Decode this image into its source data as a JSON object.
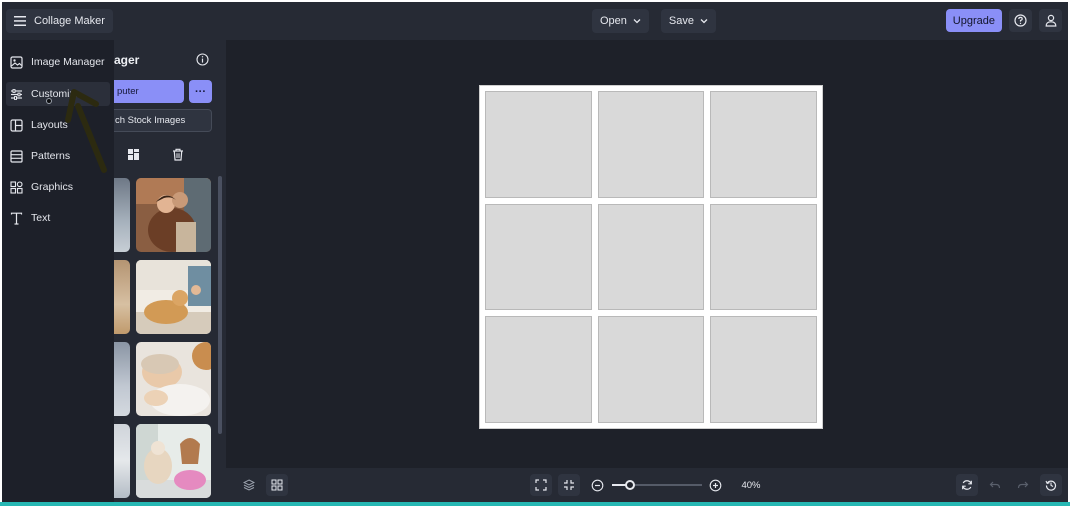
{
  "app": {
    "title": "Collage Maker"
  },
  "topbar": {
    "open_label": "Open",
    "save_label": "Save",
    "upgrade_label": "Upgrade"
  },
  "nav": {
    "items": [
      {
        "label": "Image Manager",
        "icon": "image-manager-icon"
      },
      {
        "label": "Customize",
        "icon": "sliders-icon",
        "active": true
      },
      {
        "label": "Layouts",
        "icon": "layout-icon"
      },
      {
        "label": "Patterns",
        "icon": "pattern-icon"
      },
      {
        "label": "Graphics",
        "icon": "graphics-icon"
      },
      {
        "label": "Text",
        "icon": "text-icon"
      }
    ]
  },
  "panel": {
    "title_fragment": "ager",
    "upload_fragment": "puter",
    "more_label": "···",
    "stock_fragment": "ch Stock Images"
  },
  "canvas": {
    "rows": 3,
    "cols": 3,
    "cell_color": "#d9d9d9"
  },
  "bottombar": {
    "zoom_level": "40%",
    "zoom_fraction": 0.2
  },
  "colors": {
    "accent": "#8a8ff7",
    "app_bg": "#1f222b",
    "panel_bg": "#262a34",
    "bottom_strip": "#26b7b3"
  }
}
